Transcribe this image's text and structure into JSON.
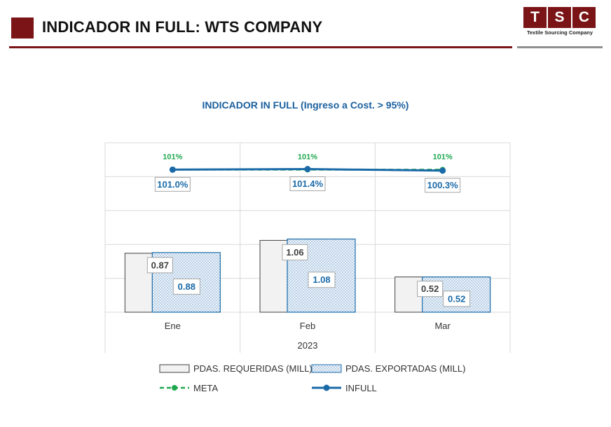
{
  "header": {
    "title": "INDICADOR IN FULL: WTS COMPANY",
    "logo_letters": [
      "T",
      "S",
      "C"
    ],
    "logo_subtitle": "Textile Sourcing Company"
  },
  "chart_data": {
    "type": "bar",
    "title": "INDICADOR IN FULL (Ingreso a Cost. > 95%)",
    "xlabel": "2023",
    "categories": [
      "Ene",
      "Feb",
      "Mar"
    ],
    "bar_ylim": [
      0,
      2.5
    ],
    "line_ylim": [
      0,
      1.2
    ],
    "series": [
      {
        "name": "PDAS. REQUERIDAS (MILL)",
        "kind": "bar",
        "values": [
          0.87,
          1.06,
          0.52
        ],
        "labels": [
          "0.87",
          "1.06",
          "0.52"
        ],
        "color": "#f2f2f2"
      },
      {
        "name": "PDAS. EXPORTADAS (MILL)",
        "kind": "bar",
        "values": [
          0.88,
          1.08,
          0.52
        ],
        "labels": [
          "0.88",
          "1.08",
          "0.52"
        ],
        "color": "#dce9f5"
      },
      {
        "name": "META",
        "kind": "line",
        "style": "dashed",
        "values": [
          1.01,
          1.01,
          1.01
        ],
        "labels": [
          "101%",
          "101%",
          "101%"
        ],
        "color": "#1fa84f"
      },
      {
        "name": "INFULL",
        "kind": "line",
        "style": "solid",
        "values": [
          1.01,
          1.014,
          1.003
        ],
        "labels": [
          "101.0%",
          "101.4%",
          "100.3%"
        ],
        "color": "#1a6aa8"
      }
    ],
    "grid": true,
    "legend": "bottom"
  }
}
